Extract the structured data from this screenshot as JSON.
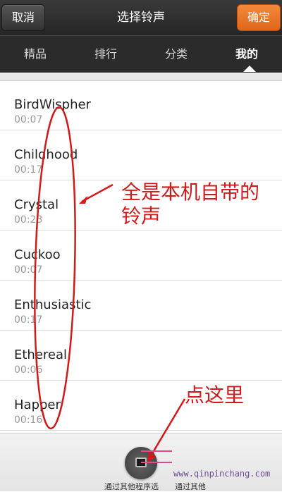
{
  "header": {
    "cancel_label": "取消",
    "title": "选择铃声",
    "ok_label": "确定"
  },
  "tabs": [
    {
      "label": "精品"
    },
    {
      "label": "排行"
    },
    {
      "label": "分类"
    },
    {
      "label": "我的"
    }
  ],
  "ringtones": [
    {
      "name": "BirdWispher",
      "duration": "00:07"
    },
    {
      "name": "Childhood",
      "duration": "00:17"
    },
    {
      "name": "Crystal",
      "duration": "00:23"
    },
    {
      "name": "Cuckoo",
      "duration": "00:07"
    },
    {
      "name": "Enthusiastic",
      "duration": "00:17"
    },
    {
      "name": "Ethereal",
      "duration": "00:06"
    },
    {
      "name": "Happer",
      "duration": "00:16"
    }
  ],
  "bottom": {
    "other_app_label": "通过其他程序选",
    "record_label": "通过其他"
  },
  "annotations": {
    "note_builtin": "全是本机自带的铃声",
    "note_click_here": "点这里"
  },
  "watermark": "www.qinpinchang.com",
  "colors": {
    "accent_orange": "#e8731f",
    "annotation_red": "#d31a1a"
  }
}
